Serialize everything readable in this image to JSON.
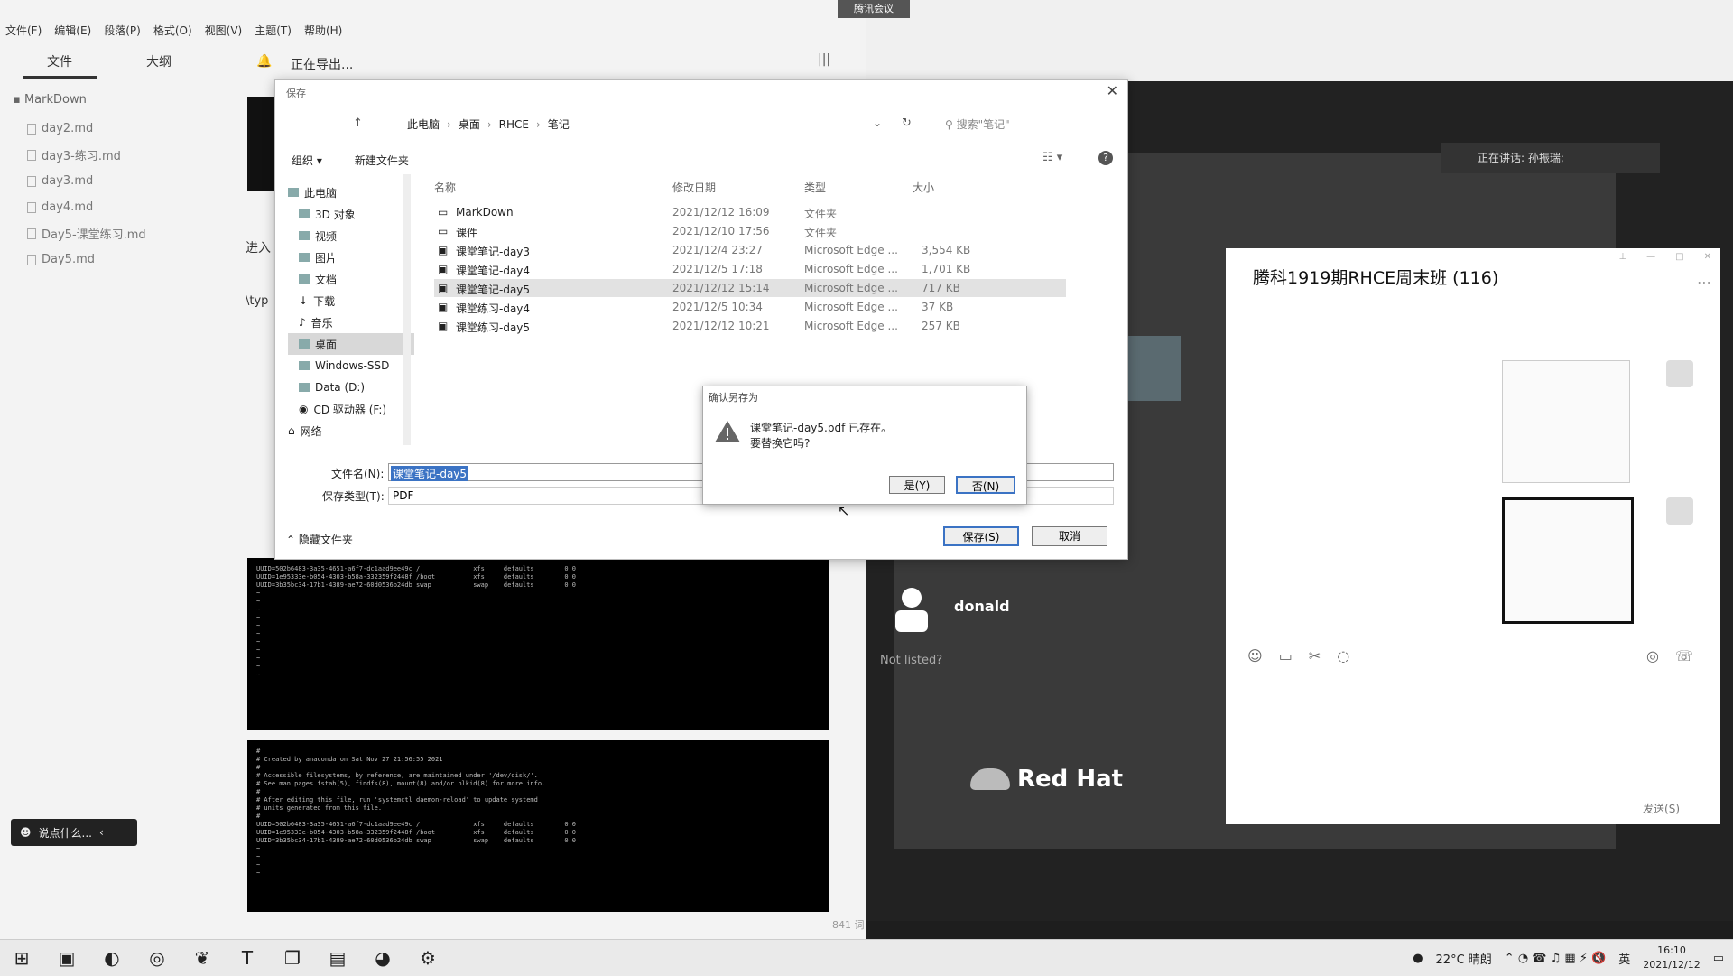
{
  "typora": {
    "menu": [
      "文件(F)",
      "编辑(E)",
      "段落(P)",
      "格式(O)",
      "视图(V)",
      "主题(T)",
      "帮助(H)"
    ],
    "tabs": {
      "files": "文件",
      "outline": "大纲"
    },
    "folder": "MarkDown",
    "files": [
      "day2.md",
      "day3-练习.md",
      "day3.md",
      "day4.md",
      "Day5-课堂练习.md",
      "Day5.md"
    ],
    "export_status": "正在导出...",
    "editor_snippet_1": "进入",
    "editor_snippet_2": "\\typ",
    "chat_pill": "说点什么...",
    "word_count": "841 词",
    "terminal1": "UUID=502b6483-3a35-4651-a6f7-dc1aad9ee49c /              xfs     defaults        0 0\nUUID=1e95333e-b054-4303-b58a-332359f2448f /boot          xfs     defaults        0 0\nUUID=3b35bc34-17b1-4389-ae72-60d0536b24db swap           swap    defaults        0 0\n~\n~\n~\n~\n~\n~\n~\n~\n~\n~\n~",
    "terminal2": "#\n# Created by anaconda on Sat Nov 27 21:56:55 2021\n#\n# Accessible filesystems, by reference, are maintained under '/dev/disk/'.\n# See man pages fstab(5), findfs(8), mount(8) and/or blkid(8) for more info.\n#\n# After editing this file, run 'systemctl daemon-reload' to update systemd\n# units generated from this file.\n#\nUUID=502b6483-3a35-4651-a6f7-dc1aad9ee49c /              xfs     defaults        0 0\nUUID=1e95333e-b054-4303-b58a-332359f2448f /boot          xfs     defaults        0 0\nUUID=3b35bc34-17b1-4389-ae72-60d0536b24db swap           swap    defaults        0 0\n~\n~\n~\n~"
  },
  "save_dialog": {
    "title": "保存",
    "breadcrumb": [
      "此电脑",
      "桌面",
      "RHCE",
      "笔记"
    ],
    "search_placeholder": "搜索\"笔记\"",
    "organize": "组织 ▾",
    "new_folder": "新建文件夹",
    "nav": [
      "此电脑",
      "3D 对象",
      "视频",
      "图片",
      "文档",
      "下载",
      "音乐",
      "桌面",
      "Windows-SSD",
      "Data (D:)",
      "CD 驱动器 (F:)",
      "网络"
    ],
    "columns": {
      "name": "名称",
      "date": "修改日期",
      "type": "类型",
      "size": "大小"
    },
    "files": [
      {
        "name": "MarkDown",
        "date": "2021/12/12 16:09",
        "type": "文件夹",
        "size": ""
      },
      {
        "name": "课件",
        "date": "2021/12/10 17:56",
        "type": "文件夹",
        "size": ""
      },
      {
        "name": "课堂笔记-day3",
        "date": "2021/12/4 23:27",
        "type": "Microsoft Edge ...",
        "size": "3,554 KB"
      },
      {
        "name": "课堂笔记-day4",
        "date": "2021/12/5 17:18",
        "type": "Microsoft Edge ...",
        "size": "1,701 KB"
      },
      {
        "name": "课堂笔记-day5",
        "date": "2021/12/12 15:14",
        "type": "Microsoft Edge ...",
        "size": "717 KB"
      },
      {
        "name": "课堂练习-day4",
        "date": "2021/12/5 10:34",
        "type": "Microsoft Edge ...",
        "size": "37 KB"
      },
      {
        "name": "课堂练习-day5",
        "date": "2021/12/12 10:21",
        "type": "Microsoft Edge ...",
        "size": "257 KB"
      }
    ],
    "filename_label": "文件名(N):",
    "filename_value": "课堂笔记-day5",
    "filetype_label": "保存类型(T):",
    "filetype_value": "PDF",
    "hide_folders": "隐藏文件夹",
    "save": "保存(S)",
    "cancel": "取消"
  },
  "confirm": {
    "title": "确认另存为",
    "line1": "课堂笔记-day5.pdf 已存在。",
    "line2": "要替换它吗?",
    "yes": "是(Y)",
    "no": "否(N)"
  },
  "meeting": {
    "tab": "腾讯会议",
    "speaking": "正在讲话: 孙振瑞;",
    "user": "donald",
    "not_listed": "Not listed?",
    "brand": "Red Hat",
    "chat_title": "腾科1919期RHCE周末班 (116)",
    "send": "发送(S)"
  },
  "taskbar": {
    "weather": "22°C  晴朗",
    "ime": "英",
    "time": "16:10",
    "date": "2021/12/12"
  }
}
